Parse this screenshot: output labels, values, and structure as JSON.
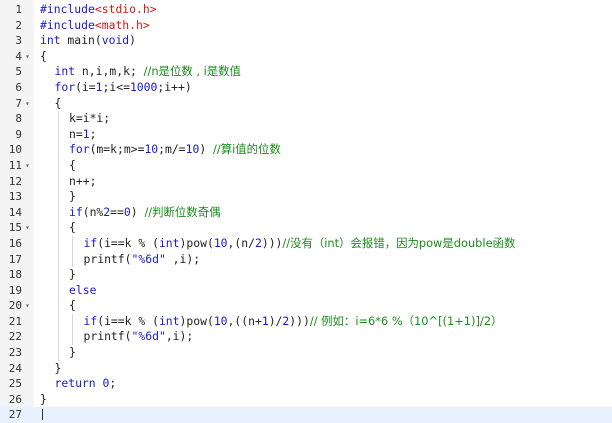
{
  "editor": {
    "colors": {
      "keyword": "#1a1acc",
      "include": "#cc1a1a",
      "number": "#1a1acc",
      "comment": "#1a8c1a",
      "string": "#1a1acc",
      "plain": "#222222",
      "current_line": "#e8f2fe"
    },
    "current_line": 27,
    "fold_markers": [
      4,
      7,
      11,
      15,
      20
    ],
    "lines": [
      {
        "n": "1",
        "indent": 0,
        "tokens": [
          {
            "t": "#include",
            "c": "kw"
          },
          {
            "t": "<stdio.h>",
            "c": "inc"
          }
        ]
      },
      {
        "n": "2",
        "indent": 0,
        "tokens": [
          {
            "t": "#include",
            "c": "kw"
          },
          {
            "t": "<math.h>",
            "c": "inc"
          }
        ]
      },
      {
        "n": "3",
        "indent": 0,
        "tokens": [
          {
            "t": "int",
            "c": "kw"
          },
          {
            "t": " main(",
            "c": "p"
          },
          {
            "t": "void",
            "c": "kw"
          },
          {
            "t": ")",
            "c": "p"
          }
        ]
      },
      {
        "n": "4",
        "indent": 0,
        "tokens": [
          {
            "t": "{",
            "c": "p"
          }
        ]
      },
      {
        "n": "5",
        "indent": 1,
        "tokens": [
          {
            "t": "int",
            "c": "kw"
          },
          {
            "t": " n,i,m,k; ",
            "c": "p"
          },
          {
            "t": "//n是位数 , i是数值",
            "c": "cm"
          }
        ]
      },
      {
        "n": "6",
        "indent": 1,
        "tokens": [
          {
            "t": "for",
            "c": "kw"
          },
          {
            "t": "(i=",
            "c": "p"
          },
          {
            "t": "1",
            "c": "num"
          },
          {
            "t": ";i<=",
            "c": "p"
          },
          {
            "t": "1000",
            "c": "num"
          },
          {
            "t": ";i++)",
            "c": "p"
          }
        ]
      },
      {
        "n": "7",
        "indent": 1,
        "tokens": [
          {
            "t": "{",
            "c": "p"
          }
        ]
      },
      {
        "n": "8",
        "indent": 2,
        "tokens": [
          {
            "t": "k=i*i;",
            "c": "p"
          }
        ]
      },
      {
        "n": "9",
        "indent": 2,
        "tokens": [
          {
            "t": "n=",
            "c": "p"
          },
          {
            "t": "1",
            "c": "num"
          },
          {
            "t": ";",
            "c": "p"
          }
        ]
      },
      {
        "n": "10",
        "indent": 2,
        "tokens": [
          {
            "t": "for",
            "c": "kw"
          },
          {
            "t": "(m=k;m>=",
            "c": "p"
          },
          {
            "t": "10",
            "c": "num"
          },
          {
            "t": ";m/=",
            "c": "p"
          },
          {
            "t": "10",
            "c": "num"
          },
          {
            "t": ") ",
            "c": "p"
          },
          {
            "t": "//算i值的位数",
            "c": "cm"
          }
        ]
      },
      {
        "n": "11",
        "indent": 2,
        "tokens": [
          {
            "t": "{",
            "c": "p"
          }
        ]
      },
      {
        "n": "12",
        "indent": 2,
        "tokens": [
          {
            "t": "n++;",
            "c": "p"
          }
        ]
      },
      {
        "n": "13",
        "indent": 2,
        "tokens": [
          {
            "t": "}",
            "c": "p"
          }
        ]
      },
      {
        "n": "14",
        "indent": 2,
        "tokens": [
          {
            "t": "if",
            "c": "kw"
          },
          {
            "t": "(n%",
            "c": "p"
          },
          {
            "t": "2",
            "c": "num"
          },
          {
            "t": "==",
            "c": "p"
          },
          {
            "t": "0",
            "c": "num"
          },
          {
            "t": ") ",
            "c": "p"
          },
          {
            "t": "//判断位数奇偶",
            "c": "cm"
          }
        ]
      },
      {
        "n": "15",
        "indent": 2,
        "tokens": [
          {
            "t": "{",
            "c": "p"
          }
        ]
      },
      {
        "n": "16",
        "indent": 3,
        "tokens": [
          {
            "t": "if",
            "c": "kw"
          },
          {
            "t": "(i==k % (",
            "c": "p"
          },
          {
            "t": "int",
            "c": "kw"
          },
          {
            "t": ")pow(",
            "c": "p"
          },
          {
            "t": "10",
            "c": "num"
          },
          {
            "t": ",(n/",
            "c": "p"
          },
          {
            "t": "2",
            "c": "num"
          },
          {
            "t": ")))",
            "c": "p"
          },
          {
            "t": "//没有（int）会报错，因为pow是double函数",
            "c": "cm"
          }
        ]
      },
      {
        "n": "17",
        "indent": 3,
        "tokens": [
          {
            "t": "printf(",
            "c": "p"
          },
          {
            "t": "\"%6d\"",
            "c": "str"
          },
          {
            "t": " ,i);",
            "c": "p"
          }
        ]
      },
      {
        "n": "18",
        "indent": 2,
        "tokens": [
          {
            "t": "}",
            "c": "p"
          }
        ]
      },
      {
        "n": "19",
        "indent": 2,
        "tokens": [
          {
            "t": "else",
            "c": "kw"
          }
        ]
      },
      {
        "n": "20",
        "indent": 2,
        "tokens": [
          {
            "t": "{",
            "c": "p"
          }
        ]
      },
      {
        "n": "21",
        "indent": 3,
        "tokens": [
          {
            "t": "if",
            "c": "kw"
          },
          {
            "t": "(i==k % (",
            "c": "p"
          },
          {
            "t": "int",
            "c": "kw"
          },
          {
            "t": ")pow(",
            "c": "p"
          },
          {
            "t": "10",
            "c": "num"
          },
          {
            "t": ",((n+",
            "c": "p"
          },
          {
            "t": "1",
            "c": "num"
          },
          {
            "t": ")/",
            "c": "p"
          },
          {
            "t": "2",
            "c": "num"
          },
          {
            "t": ")))",
            "c": "p"
          },
          {
            "t": "// 例如：i=6*6 %（10^[(1+1)]/2）",
            "c": "cm"
          }
        ]
      },
      {
        "n": "22",
        "indent": 3,
        "tokens": [
          {
            "t": "printf(",
            "c": "p"
          },
          {
            "t": "\"%6d\"",
            "c": "str"
          },
          {
            "t": ",i);",
            "c": "p"
          }
        ]
      },
      {
        "n": "23",
        "indent": 2,
        "tokens": [
          {
            "t": "}",
            "c": "p"
          }
        ]
      },
      {
        "n": "24",
        "indent": 1,
        "tokens": [
          {
            "t": "}",
            "c": "p"
          }
        ]
      },
      {
        "n": "25",
        "indent": 1,
        "tokens": [
          {
            "t": "return",
            "c": "kw"
          },
          {
            "t": " ",
            "c": "p"
          },
          {
            "t": "0",
            "c": "num"
          },
          {
            "t": ";",
            "c": "p"
          }
        ]
      },
      {
        "n": "26",
        "indent": 0,
        "tokens": [
          {
            "t": "}",
            "c": "p"
          }
        ]
      },
      {
        "n": "27",
        "indent": 0,
        "tokens": []
      }
    ]
  }
}
